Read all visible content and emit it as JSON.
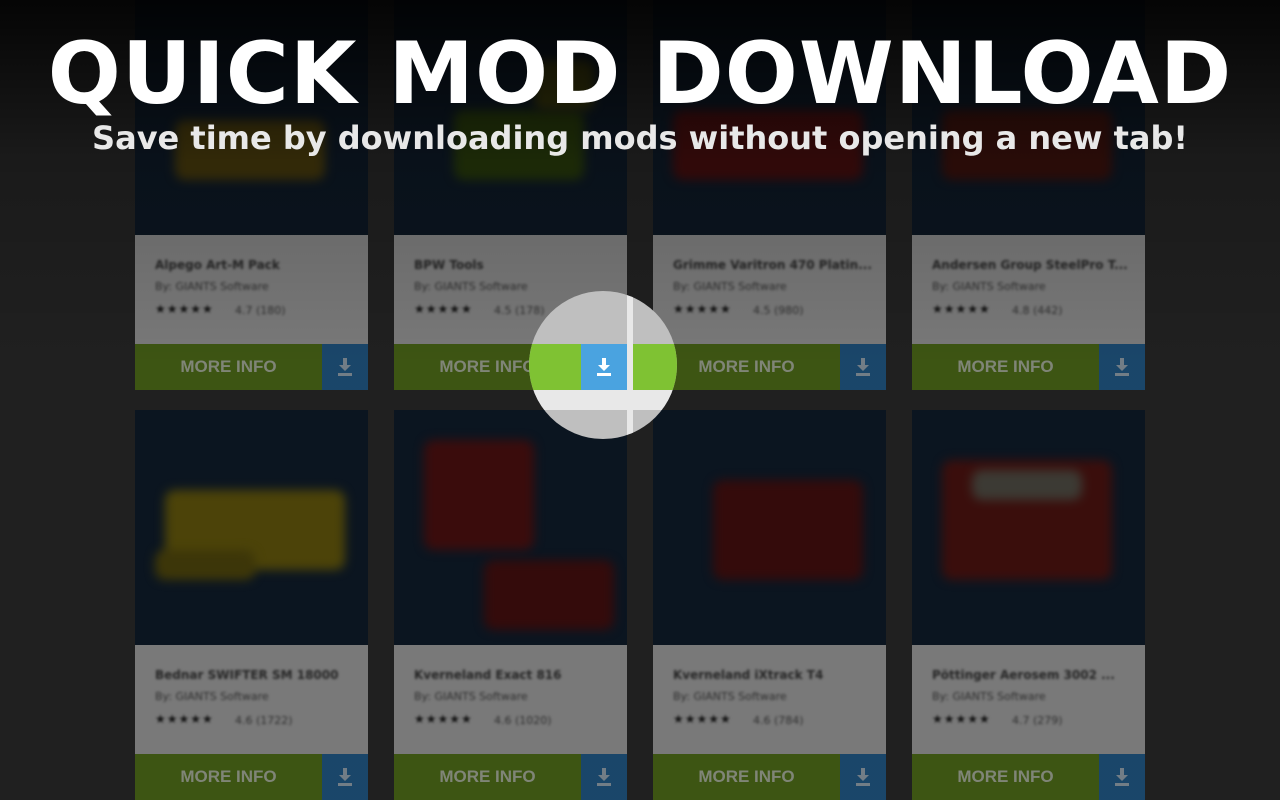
{
  "headline": "QUICK MOD DOWNLOAD",
  "subheadline": "Save time by downloading mods without opening a new tab!",
  "more_info_label": "MORE INFO",
  "colors": {
    "more_info_bg": "#6f9a22",
    "download_bg": "#2f7fc0",
    "download_highlight": "#4aa3e0"
  },
  "mods": [
    {
      "title": "Alpego Art-M Pack",
      "author": "By: GIANTS Software",
      "stars": "★★★★★",
      "rating": "4.7 (180)"
    },
    {
      "title": "BPW Tools",
      "author": "By: GIANTS Software",
      "stars": "★★★★★",
      "rating": "4.5 (178)"
    },
    {
      "title": "Grimme Varitron 470 Platin...",
      "author": "By: GIANTS Software",
      "stars": "★★★★★",
      "rating": "4.5 (980)"
    },
    {
      "title": "Andersen Group SteelPro T...",
      "author": "By: GIANTS Software",
      "stars": "★★★★★",
      "rating": "4.8 (442)"
    },
    {
      "title": "Bednar SWIFTER SM 18000",
      "author": "By: GIANTS Software",
      "stars": "★★★★★",
      "rating": "4.6 (1722)"
    },
    {
      "title": "Kverneland Exact 816",
      "author": "By: GIANTS Software",
      "stars": "★★★★★",
      "rating": "4.6 (1020)"
    },
    {
      "title": "Kverneland iXtrack T4",
      "author": "By: GIANTS Software",
      "stars": "★★★★★",
      "rating": "4.6 (784)"
    },
    {
      "title": "Pöttinger Aerosem 3002 ...",
      "author": "By: GIANTS Software",
      "stars": "★★★★★",
      "rating": "4.7 (279)"
    }
  ]
}
